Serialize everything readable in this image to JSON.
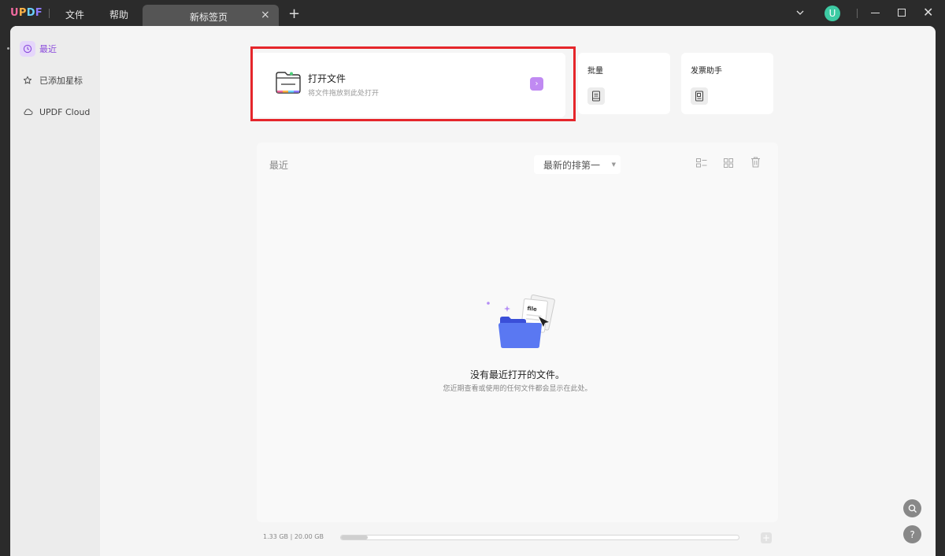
{
  "titlebar": {
    "logo": "UPDF",
    "menu_file": "文件",
    "menu_help": "帮助",
    "tab_label": "新标签页",
    "tab_close": "×",
    "new_tab": "+",
    "avatar_letter": "U"
  },
  "sidebar": {
    "items": [
      {
        "label": "最近",
        "icon": "clock-icon",
        "active": true
      },
      {
        "label": "已添加星标",
        "icon": "star-icon",
        "active": false
      },
      {
        "label": "UPDF Cloud",
        "icon": "cloud-icon",
        "active": false
      }
    ]
  },
  "open_card": {
    "title": "打开文件",
    "subtitle": "将文件拖放到此处打开",
    "arrow": "›"
  },
  "tools": {
    "batch_label": "批量",
    "invoice_label": "发票助手"
  },
  "recent": {
    "title": "最近",
    "sort_value": "最新的排第一",
    "empty_title": "没有最近打开的文件。",
    "empty_subtitle": "您近期查看或使用的任何文件都会显示在此处。"
  },
  "storage": {
    "text": "1.33 GB | 20.00 GB",
    "used_fraction": 0.0665,
    "add_label": "+"
  },
  "colors": {
    "accent": "#8b4bdc",
    "highlight": "#e5262b",
    "arrow_bg": "#c08af2"
  }
}
